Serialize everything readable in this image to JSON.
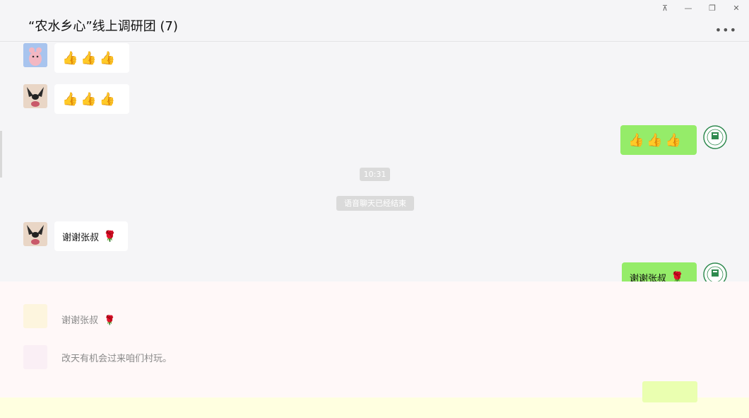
{
  "window": {
    "title": "“农水乡心”线上调研团 (7)",
    "more_label": "•••",
    "buttons": [
      "⊼",
      "—",
      "❐",
      "✕"
    ]
  },
  "messages": [
    {
      "side": "left",
      "avatar": "pig-avatar-icon",
      "content": [
        "👍",
        "👍",
        "👍"
      ]
    },
    {
      "side": "left",
      "avatar": "dog-avatar-icon",
      "content": [
        "👍",
        "👍",
        "👍"
      ]
    },
    {
      "side": "right",
      "avatar": "logo-avatar-icon",
      "content": [
        "👍",
        "👍",
        "👍"
      ]
    },
    {
      "side": "left",
      "avatar": "dog-avatar-icon",
      "text": "谢谢张叔",
      "emoji": "🌹"
    },
    {
      "side": "right",
      "avatar": "logo-avatar-icon",
      "text": "谢谢张叔",
      "emoji": "🌹"
    }
  ],
  "timestamp": "10:31",
  "system_notice": "语音聊天已经结束",
  "faded_messages": [
    {
      "text": "谢谢张叔",
      "emoji": "🌹"
    },
    {
      "text": "改天有机会过来咱们村玩。"
    }
  ],
  "colors": {
    "own_bubble": "#95ec69",
    "other_bubble": "#ffffff",
    "background": "#f5f5f7"
  }
}
